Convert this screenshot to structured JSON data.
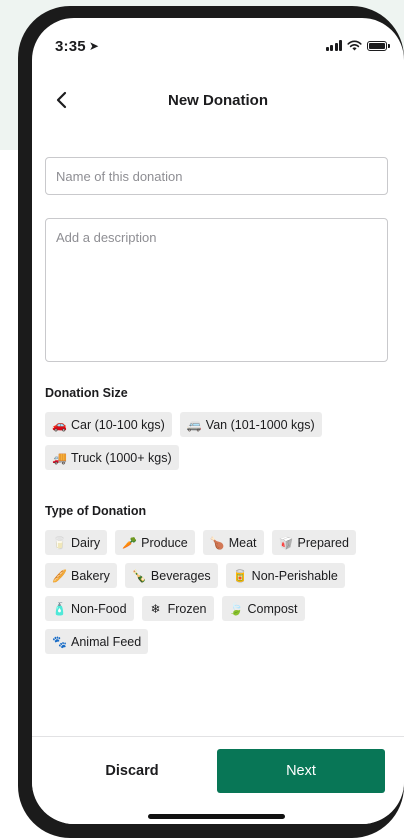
{
  "status_bar": {
    "time": "3:35"
  },
  "header": {
    "title": "New Donation"
  },
  "form": {
    "name_placeholder": "Name of this donation",
    "description_placeholder": "Add a description"
  },
  "donation_size": {
    "label": "Donation Size",
    "options": [
      {
        "icon": "car-icon",
        "label": "Car (10-100 kgs)"
      },
      {
        "icon": "van-icon",
        "label": "Van (101-1000 kgs)"
      },
      {
        "icon": "truck-icon",
        "label": "Truck (1000+ kgs)"
      }
    ]
  },
  "donation_type": {
    "label": "Type of Donation",
    "options": [
      {
        "icon": "dairy-icon",
        "label": "Dairy"
      },
      {
        "icon": "carrot-icon",
        "label": "Produce"
      },
      {
        "icon": "drumstick-icon",
        "label": "Meat"
      },
      {
        "icon": "takeout-box-icon",
        "label": "Prepared"
      },
      {
        "icon": "bread-icon",
        "label": "Bakery"
      },
      {
        "icon": "bottles-icon",
        "label": "Beverages"
      },
      {
        "icon": "can-icon",
        "label": "Non-Perishable"
      },
      {
        "icon": "bottle-icon",
        "label": "Non-Food"
      },
      {
        "icon": "snowflake-icon",
        "label": "Frozen"
      },
      {
        "icon": "leaf-icon",
        "label": "Compost"
      },
      {
        "icon": "animal-icon",
        "label": "Animal Feed"
      }
    ]
  },
  "footer": {
    "discard_label": "Discard",
    "next_label": "Next",
    "next_color": "#087656"
  }
}
